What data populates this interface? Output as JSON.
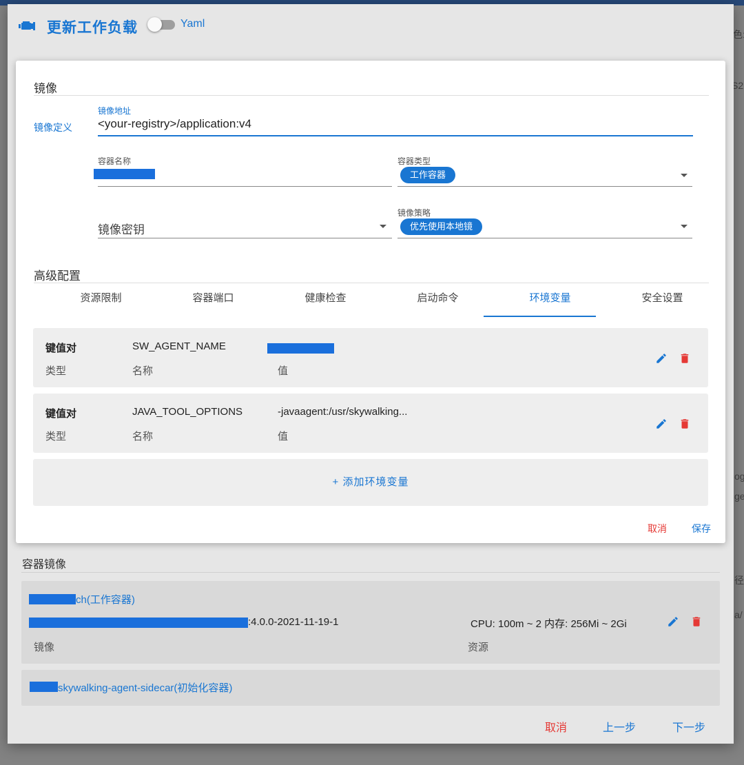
{
  "background": {
    "side_text_1": "色:",
    "side_text_2": "S2",
    "side_text_3": "og",
    "side_text_4": "ge",
    "side_text_5": "径",
    "side_text_6": "a/"
  },
  "header": {
    "title": "更新工作负载",
    "toggle_label": "Yaml",
    "toggle_on": false
  },
  "image_section": {
    "title": "镜像",
    "definition_label": "镜像定义",
    "address_label": "镜像地址",
    "address_value": "<your-registry>/application:v4",
    "container_name_label": "容器名称",
    "container_name_value": "",
    "container_type_label": "容器类型",
    "container_type_value": "工作容器",
    "secret_placeholder": "镜像密钥",
    "pull_policy_label": "镜像策略",
    "pull_policy_value": "优先使用本地镜"
  },
  "advanced": {
    "title": "高级配置",
    "tabs": [
      {
        "label": "资源限制"
      },
      {
        "label": "容器端口"
      },
      {
        "label": "健康检查"
      },
      {
        "label": "启动命令"
      },
      {
        "label": "环境变量"
      },
      {
        "label": "安全设置"
      }
    ],
    "active_tab": "环境变量",
    "env_vars": [
      {
        "type": "键值对",
        "name": "SW_AGENT_NAME",
        "value": "",
        "type_label": "类型",
        "name_label": "名称",
        "value_label": "值"
      },
      {
        "type": "键值对",
        "name": "JAVA_TOOL_OPTIONS",
        "value": "-javaagent:/usr/skywalking...",
        "type_label": "类型",
        "name_label": "名称",
        "value_label": "值"
      }
    ],
    "add_env_label": "+  添加环境变量",
    "cancel_label": "取消",
    "save_label": "保存"
  },
  "container_images": {
    "title": "容器镜像",
    "items": [
      {
        "name_suffix": "ch(工作容器)",
        "image_suffix": ":4.0.0-2021-11-19-1",
        "resources": "CPU: 100m ~ 2   内存: 256Mi ~ 2Gi",
        "image_label": "镜像",
        "resources_label": "资源"
      },
      {
        "name_suffix": "skywalking-agent-sidecar(初始化容器)"
      }
    ]
  },
  "footer": {
    "cancel": "取消",
    "prev": "上一步",
    "next": "下一步"
  },
  "colors": {
    "primary": "#1976d2",
    "danger": "#e53935",
    "redaction": "#1a6fdc"
  }
}
